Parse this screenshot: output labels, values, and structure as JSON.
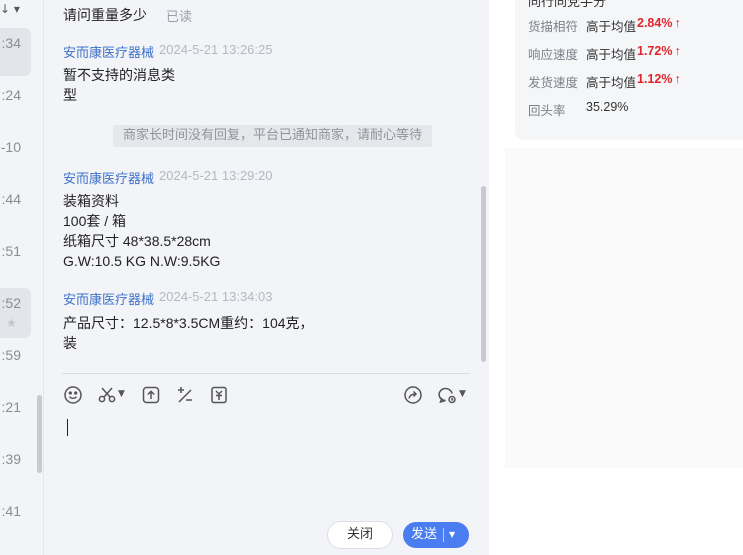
{
  "left_list": {
    "times": [
      ":34",
      ":24",
      "-10",
      ":44",
      ":51",
      ":52",
      ":59",
      ":21",
      ":39",
      ":41"
    ]
  },
  "chat": {
    "top_message": "请问重量多少",
    "read_status": "已读",
    "messages": [
      {
        "sender": "安而康医疗器械",
        "time": "2024-5-21 13:26:25",
        "text": "暂不支持的消息类\n型"
      },
      {
        "sender": "安而康医疗器械",
        "time": "2024-5-21 13:29:20",
        "text": "装箱资料\n100套 / 箱\n纸箱尺寸 48*38.5*28cm\nG.W:10.5 KG N.W:9.5KG"
      },
      {
        "sender": "安而康医疗器械",
        "time": "2024-5-21 13:34:03",
        "text": "产品尺寸：12.5*8*3.5CM重约：104克，\n装"
      }
    ],
    "system_notice": "商家长时间没有回复，平台已通知商家，请耐心等待",
    "close_label": "关闭",
    "send_label": "发送"
  },
  "shop_stats": {
    "title": "同行同党手分",
    "rows": [
      {
        "label": "货描相符",
        "compare": "高于均值",
        "value": "2.84%"
      },
      {
        "label": "响应速度",
        "compare": "高于均值",
        "value": "1.72%"
      },
      {
        "label": "发货速度",
        "compare": "高于均值",
        "value": "1.12%"
      }
    ],
    "repurchase_label": "回头率",
    "repurchase_value": "35.29%"
  },
  "colors": {
    "accent": "#4a7df0",
    "sender": "#3f72c9",
    "up_red": "#e0262d"
  }
}
